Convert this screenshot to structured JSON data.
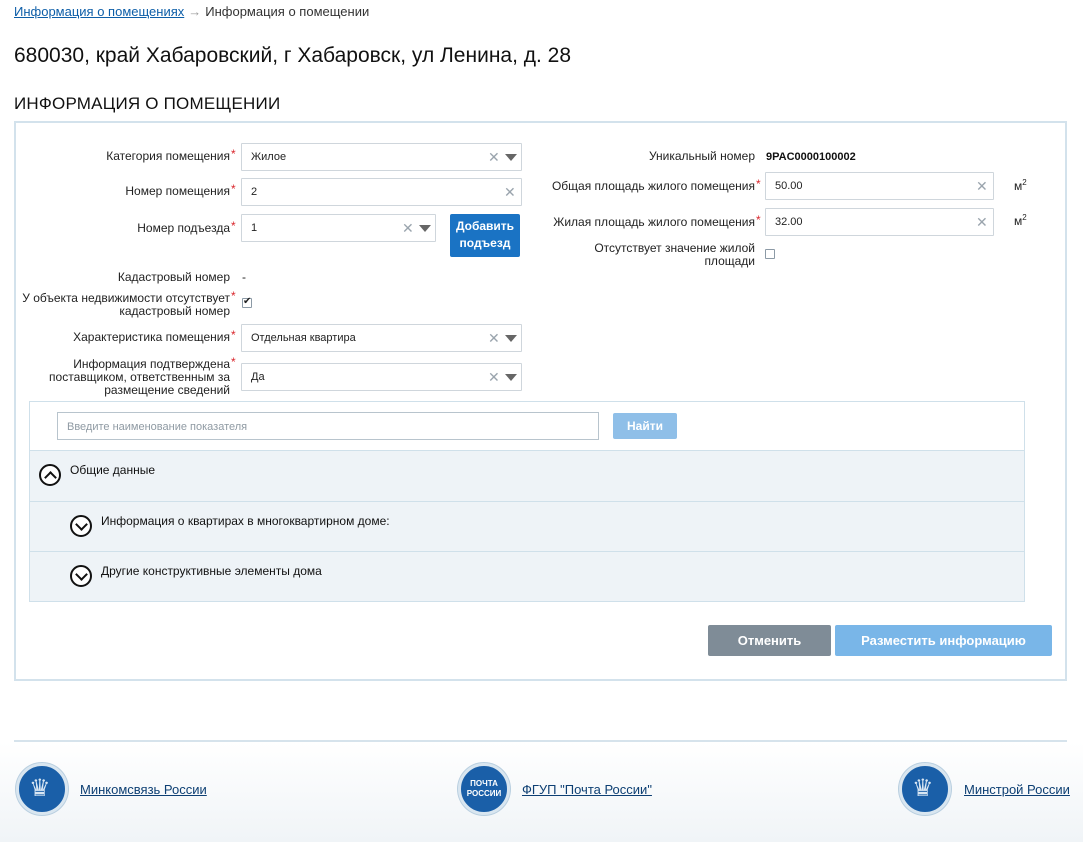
{
  "breadcrumb": {
    "parent": "Информация о помещениях",
    "separator": "→",
    "current": "Информация о помещении"
  },
  "address": "680030, край Хабаровский, г Хабаровск, ул Ленина, д. 28",
  "section_title": "ИНФОРМАЦИЯ О ПОМЕЩЕНИИ",
  "required_mark": "*",
  "form": {
    "category": {
      "label": "Категория помещения",
      "value": "Жилое"
    },
    "room_number": {
      "label": "Номер помещения",
      "value": "2"
    },
    "entrance": {
      "label": "Номер подъезда",
      "value": "1",
      "add_button_line1": "Добавить",
      "add_button_line2": "подъезд"
    },
    "cadastral": {
      "label": "Кадастровый номер",
      "value": "-"
    },
    "no_cadastral": {
      "label_line1": "У объекта недвижимости отсутствует",
      "label_line2": "кадастровый номер",
      "checked": true
    },
    "characteristic": {
      "label": "Характеристика помещения",
      "value": "Отдельная квартира"
    },
    "confirmed": {
      "label_line1": "Информация подтверждена",
      "label_line2": "поставщиком, ответственным за",
      "label_line3": "размещение сведений",
      "value": "Да"
    },
    "unique_number": {
      "label": "Уникальный номер",
      "value": "9PAC0000100002"
    },
    "total_area": {
      "label": "Общая площадь жилого помещения",
      "value": "50.00",
      "unit": "м",
      "unit_sup": "2"
    },
    "living_area": {
      "label": "Жилая площадь жилого помещения",
      "value": "32.00",
      "unit": "м",
      "unit_sup": "2"
    },
    "no_living_area": {
      "label_line1": "Отсутствует значение жилой",
      "label_line2": "площади",
      "checked": false
    }
  },
  "indicators": {
    "search_placeholder": "Введите наименование показателя",
    "find_button": "Найти",
    "sections": [
      {
        "label": "Общие данные",
        "expanded": true
      },
      {
        "label": "Информация о квартирах в многоквартирном доме:",
        "expanded": false
      },
      {
        "label": "Другие конструктивные элементы дома",
        "expanded": false
      }
    ]
  },
  "actions": {
    "cancel": "Отменить",
    "submit": "Разместить информацию"
  },
  "footer": {
    "links": [
      {
        "label": "Минкомсвязь России",
        "icon": "coat-of-arms-icon"
      },
      {
        "label": "ФГУП \"Почта России\"",
        "icon": "pochta-logo-icon",
        "logo_line1": "ПОЧТА",
        "logo_line2": "РОССИИ"
      },
      {
        "label": "Минстрой России",
        "icon": "coat-of-arms-icon"
      }
    ]
  },
  "colors": {
    "link": "#0d5ea8",
    "primary_button": "#1a73c4",
    "panel_border": "#d3e2ec",
    "required": "#d9262c"
  }
}
